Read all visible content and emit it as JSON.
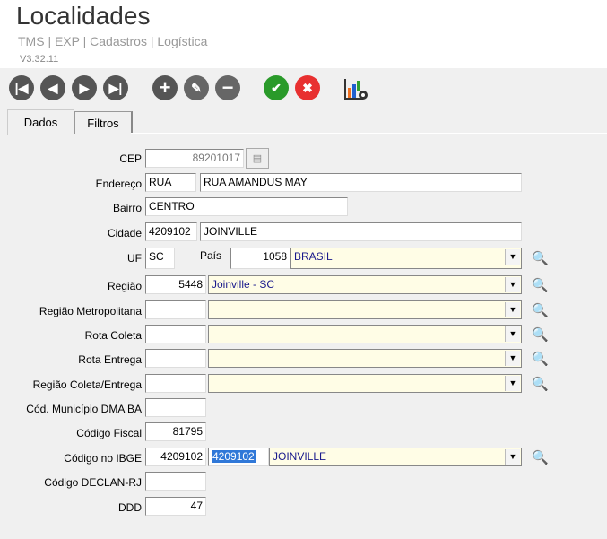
{
  "header": {
    "title": "Localidades",
    "breadcrumb": "TMS | EXP | Cadastros | Logística",
    "version": "V3.32.11"
  },
  "toolbar": [
    {
      "name": "first-icon",
      "glyph": "⏮"
    },
    {
      "name": "prev-icon",
      "glyph": "◀"
    },
    {
      "name": "next-icon",
      "glyph": "▶"
    },
    {
      "name": "last-icon",
      "glyph": "⏭"
    },
    {
      "name": "add-icon",
      "glyph": "+"
    },
    {
      "name": "edit-icon",
      "glyph": "✎"
    },
    {
      "name": "remove-icon",
      "glyph": "−"
    },
    {
      "name": "confirm-icon",
      "glyph": "✔"
    },
    {
      "name": "cancel-icon",
      "glyph": "✖"
    }
  ],
  "tabs": {
    "dados": "Dados",
    "filtros": "Filtros"
  },
  "form": {
    "cep": {
      "label": "CEP",
      "value": "89201017"
    },
    "endereco": {
      "label": "Endereço",
      "tipo": "RUA",
      "value": "RUA AMANDUS MAY"
    },
    "bairro": {
      "label": "Bairro",
      "value": "CENTRO"
    },
    "cidade": {
      "label": "Cidade",
      "code": "4209102",
      "value": "JOINVILLE"
    },
    "uf": {
      "label": "UF",
      "value": "SC"
    },
    "pais": {
      "label": "País",
      "code": "1058",
      "value": "BRASIL"
    },
    "regiao": {
      "label": "Região",
      "code": "5448",
      "value": "Joinville - SC"
    },
    "regiao_metro": {
      "label": "Região Metropolitana",
      "code": "",
      "value": ""
    },
    "rota_coleta": {
      "label": "Rota Coleta",
      "code": "",
      "value": ""
    },
    "rota_entrega": {
      "label": "Rota Entrega",
      "code": "",
      "value": ""
    },
    "regiao_ce": {
      "label": "Região Coleta/Entrega",
      "code": "",
      "value": ""
    },
    "cod_mun": {
      "label": "Cód. Município DMA BA",
      "value": ""
    },
    "cod_fiscal": {
      "label": "Código Fiscal",
      "value": "81795"
    },
    "ibge": {
      "label": "Código no IBGE",
      "code": "4209102",
      "sel": "4209102",
      "value": "JOINVILLE"
    },
    "declan": {
      "label": "Código DECLAN-RJ",
      "value": ""
    },
    "ddd": {
      "label": "DDD",
      "value": "47"
    }
  }
}
